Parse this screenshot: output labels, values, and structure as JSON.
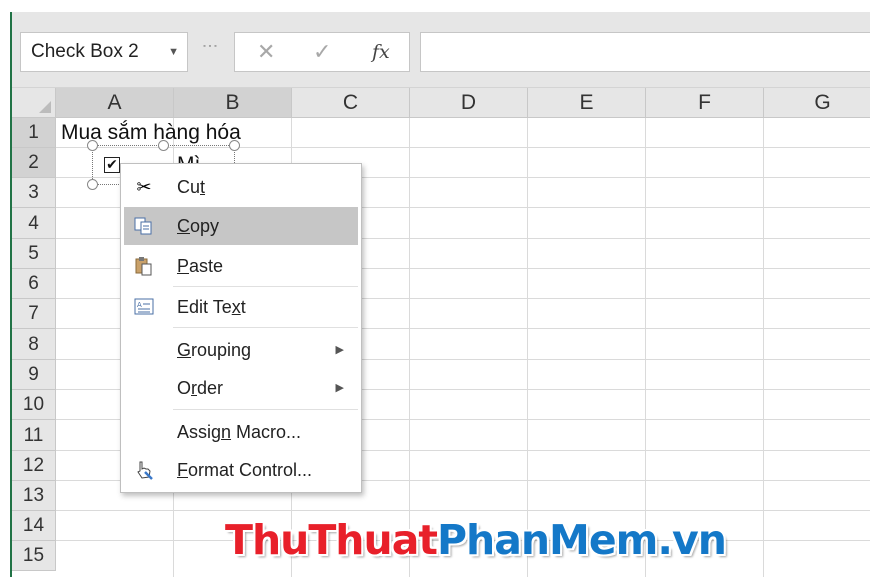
{
  "formula_bar": {
    "name_box": "Check Box 2",
    "cancel_icon": "✕",
    "enter_icon": "✓",
    "function_label": "fx",
    "formula_value": ""
  },
  "columns": [
    "A",
    "B",
    "C",
    "D",
    "E",
    "F",
    "G"
  ],
  "rows": [
    "1",
    "2",
    "3",
    "4",
    "5",
    "6",
    "7",
    "8",
    "9",
    "10",
    "11",
    "12",
    "13",
    "14",
    "15"
  ],
  "cells": {
    "a1": "Mua sắm hàng hóa",
    "b2": "Mì"
  },
  "checkbox": {
    "checked_mark": "✔"
  },
  "context_menu": {
    "cut": {
      "pre": "Cu",
      "u": "t",
      "post": ""
    },
    "copy": {
      "pre": "",
      "u": "C",
      "post": "opy"
    },
    "paste": {
      "pre": "",
      "u": "P",
      "post": "aste"
    },
    "edit_text": {
      "pre": "Edit Te",
      "u": "x",
      "post": "t"
    },
    "grouping": {
      "pre": "",
      "u": "G",
      "post": "rouping"
    },
    "order": {
      "pre": "O",
      "u": "r",
      "post": "der"
    },
    "assign_macro": {
      "pre": "Assig",
      "u": "n",
      "post": " Macro..."
    },
    "format_control": {
      "pre": "",
      "u": "F",
      "post": "ormat Control..."
    }
  },
  "watermark": {
    "part1": "ThuThuat",
    "part2": "PhanMem.vn"
  }
}
